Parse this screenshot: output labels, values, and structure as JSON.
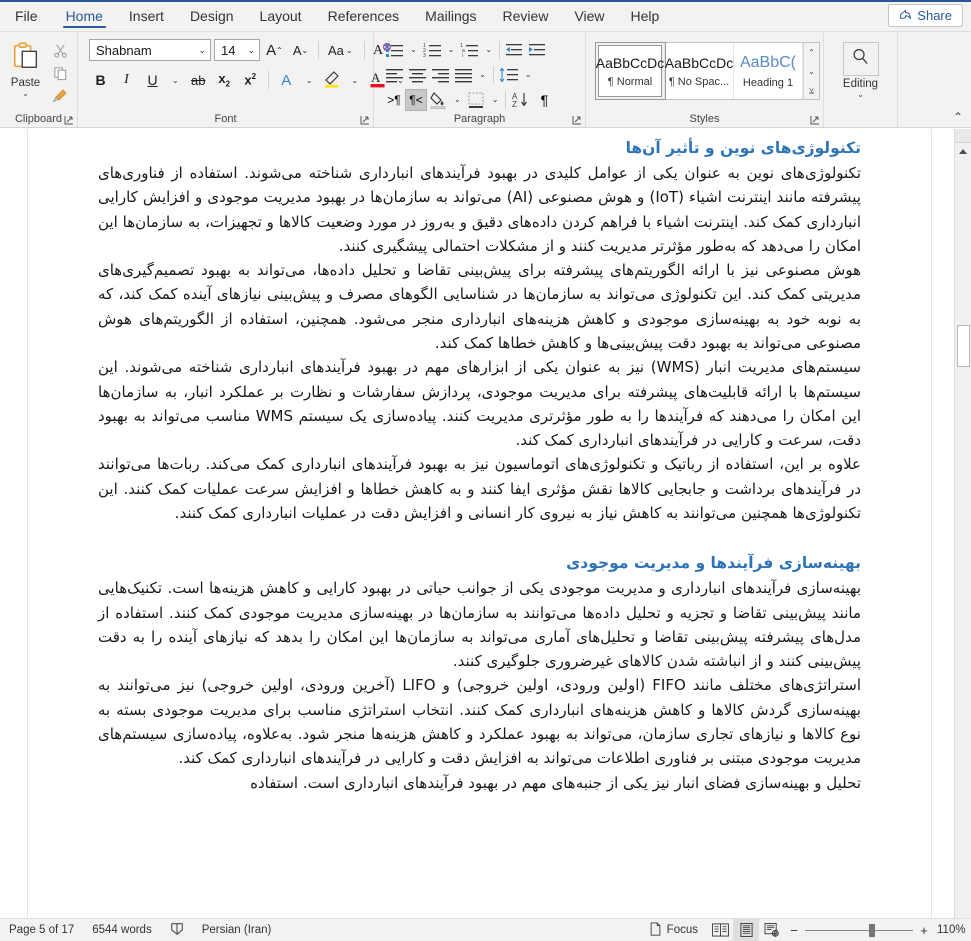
{
  "window": {
    "accent_color": "#2b579a",
    "ribbon_bg": "#f3f2f1"
  },
  "tabs": [
    {
      "label": "File",
      "active": false
    },
    {
      "label": "Home",
      "active": true
    },
    {
      "label": "Insert",
      "active": false
    },
    {
      "label": "Design",
      "active": false
    },
    {
      "label": "Layout",
      "active": false
    },
    {
      "label": "References",
      "active": false
    },
    {
      "label": "Mailings",
      "active": false
    },
    {
      "label": "Review",
      "active": false
    },
    {
      "label": "View",
      "active": false
    },
    {
      "label": "Help",
      "active": false
    }
  ],
  "share": {
    "label": "Share"
  },
  "ribbon": {
    "groups": [
      {
        "name": "Clipboard",
        "label": "Clipboard"
      },
      {
        "name": "Font",
        "label": "Font"
      },
      {
        "name": "Paragraph",
        "label": "Paragraph"
      },
      {
        "name": "Styles",
        "label": "Styles"
      },
      {
        "name": "Editing",
        "label": "Editing"
      }
    ],
    "clipboard": {
      "paste_label": "Paste",
      "cut_tip": "Cut",
      "copy_tip": "Copy",
      "format_painter_tip": "Format Painter"
    },
    "font": {
      "font_name": "Shabnam",
      "font_size": "14",
      "grow_font": "A",
      "shrink_font": "A",
      "change_case": "Aa",
      "clear_formatting": "A",
      "bold": "B",
      "italic": "I",
      "underline": "U",
      "strikethrough": "ab",
      "subscript": "x",
      "superscript": "x",
      "text_effects": "A",
      "highlight": "A",
      "font_color": "A"
    },
    "paragraph": {
      "bullets": "bullets",
      "numbering": "numbering",
      "multilevel": "multilevel-list",
      "decrease_indent": "decrease-indent",
      "increase_indent": "increase-indent",
      "align_left": "align-left",
      "center": "center",
      "align_right": "align-right",
      "justify": "justify",
      "line_spacing": "line-spacing",
      "ltr": ">¶",
      "rtl": "¶<",
      "shading": "shading",
      "borders": "borders",
      "sort": "sort",
      "show_marks": "¶"
    },
    "styles": {
      "items": [
        {
          "preview": "AaBbCcDc",
          "name": "¶ Normal",
          "selected": true,
          "heading": false
        },
        {
          "preview": "AaBbCcDc",
          "name": "¶ No Spac...",
          "selected": false,
          "heading": false
        },
        {
          "preview": "AaBbC(",
          "name": "Heading 1",
          "selected": false,
          "heading": true
        }
      ]
    },
    "editing": {
      "label": "Editing",
      "icon": "search-icon"
    }
  },
  "document": {
    "blocks": [
      {
        "type": "heading",
        "text": "تکنولوژی‌های نوین و تأثیر آن‌ها"
      },
      {
        "type": "paragraph",
        "text": "تکنولوژی‌های نوین به عنوان یکی از عوامل کلیدی در بهبود فرآیندهای انبارداری شناخته می‌شوند. استفاده از فناوری‌های پیشرفته مانند اینترنت اشیاء (IoT) و هوش مصنوعی (AI) می‌تواند به سازمان‌ها در بهبود مدیریت موجودی و افزایش کارایی انبارداری کمک کند. اینترنت اشیاء با فراهم کردن داده‌های دقیق و به‌روز در مورد وضعیت کالاها و تجهیزات، به سازمان‌ها این امکان را می‌دهد که به‌طور مؤثرتر مدیریت کنند و از مشکلات احتمالی پیشگیری کنند."
      },
      {
        "type": "paragraph",
        "text": "هوش مصنوعی نیز با ارائه الگوریتم‌های پیشرفته برای پیش‌بینی تقاضا و تحلیل داده‌ها، می‌تواند به بهبود تصمیم‌گیری‌های مدیریتی کمک کند. این تکنولوژی می‌تواند به سازمان‌ها در شناسایی الگوهای مصرف و پیش‌بینی نیازهای آینده کمک کند، که به نوبه خود به بهینه‌سازی موجودی و کاهش هزینه‌های انبارداری منجر می‌شود. همچنین، استفاده از الگوریتم‌های هوش مصنوعی می‌تواند به بهبود دقت پیش‌بینی‌ها و کاهش خطاها کمک کند."
      },
      {
        "type": "paragraph",
        "text": "سیستم‌های مدیریت انبار (WMS) نیز به عنوان یکی از ابزارهای مهم در بهبود فرآیندهای انبارداری شناخته می‌شوند. این سیستم‌ها با ارائه قابلیت‌های پیشرفته برای مدیریت موجودی، پردازش سفارشات و نظارت بر عملکرد انبار، به سازمان‌ها این امکان را می‌دهند که فرآیندها را به طور مؤثرتری مدیریت کنند. پیاده‌سازی یک سیستم WMS مناسب می‌تواند به بهبود دقت، سرعت و کارایی در فرآیندهای انبارداری کمک کند."
      },
      {
        "type": "paragraph",
        "text": "علاوه بر این، استفاده از رباتیک و تکنولوژی‌های اتوماسیون نیز به بهبود فرآیندهای انبارداری کمک می‌کند. ربات‌ها می‌توانند در فرآیندهای برداشت و جابجایی کالاها نقش مؤثری ایفا کنند و به کاهش خطاها و افزایش سرعت عملیات کمک کنند. این تکنولوژی‌ها همچنین می‌توانند به کاهش نیاز به نیروی کار انسانی و افزایش دقت در عملیات انبارداری کمک کنند."
      },
      {
        "type": "heading2",
        "text": "بهینه‌سازی فرآیندها و مدیریت موجودی"
      },
      {
        "type": "paragraph",
        "text": "بهینه‌سازی فرآیندهای انبارداری و مدیریت موجودی یکی از جوانب حیاتی در بهبود کارایی و کاهش هزینه‌ها است. تکنیک‌هایی مانند پیش‌بینی تقاضا و تجزیه و تحلیل داده‌ها می‌توانند به سازمان‌ها در بهینه‌سازی مدیریت موجودی کمک کنند. استفاده از مدل‌های پیشرفته پیش‌بینی تقاضا و تحلیل‌های آماری می‌تواند به سازمان‌ها این امکان را بدهد که نیازهای آینده را به دقت پیش‌بینی کنند و از انباشته شدن کالاهای غیرضروری جلوگیری کنند."
      },
      {
        "type": "paragraph",
        "text": "استراتژی‌های مختلف مانند FIFO (اولین ورودی، اولین خروجی) و LIFO (آخرین ورودی، اولین خروجی) نیز می‌توانند به بهینه‌سازی گردش کالاها و کاهش هزینه‌های انبارداری کمک کنند. انتخاب استراتژی مناسب برای مدیریت موجودی بسته به نوع کالاها و نیازهای تجاری سازمان، می‌تواند به بهبود عملکرد و کاهش هزینه‌ها منجر شود. به‌علاوه، پیاده‌سازی سیستم‌های مدیریت موجودی مبتنی بر فناوری اطلاعات می‌تواند به افزایش دقت و کارایی در فرآیندهای انبارداری کمک کند."
      },
      {
        "type": "paragraph_clipped",
        "text": "تحلیل و بهینه‌سازی فضای انبار نیز یکی از جنبه‌های مهم در بهبود فرآیندهای انبارداری است. استفاده"
      }
    ]
  },
  "status": {
    "page": "Page 5 of 17",
    "words": "6544 words",
    "proofing_icon": "proofing-icon",
    "language": "Persian (Iran)",
    "focus": "Focus",
    "view_read": "read-mode-icon",
    "view_print": "print-layout-icon",
    "view_web": "web-layout-icon",
    "zoom_out": "−",
    "zoom_in": "+",
    "zoom_value": "110%"
  }
}
